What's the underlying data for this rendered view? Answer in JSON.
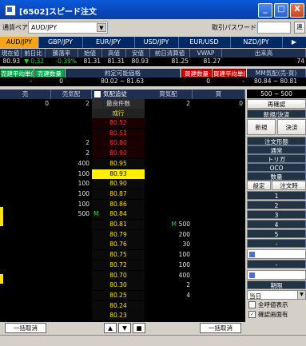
{
  "window": {
    "title": "[6502]スピード注文",
    "min": "_",
    "max": "□",
    "close": "X"
  },
  "toolbar": {
    "pair_label": "通貨ペア",
    "pair_value": "AUD/JPY",
    "password_label": "取引パスワード",
    "password_value": "",
    "link_btn": "連"
  },
  "tabs": [
    "AUD/JPY",
    "GBP/JPY",
    "EUR/JPY",
    "USD/JPY",
    "EUR/USD",
    "NZD/JPY"
  ],
  "market": {
    "headers": [
      "現在値",
      "前日比",
      "騰落率",
      "始値",
      "高値",
      "安値",
      "前日清算値",
      "VWAP",
      "出来高"
    ],
    "values": [
      "80.93",
      "▼",
      "0.32",
      "-0.39%",
      "81.31",
      "81.31",
      "80.93",
      "81.25",
      "81.27",
      "74"
    ]
  },
  "summary": {
    "sell_avg_label": "売建平均単価",
    "sell_qty_label": "売建数量",
    "range_label": "約定可能価格",
    "buy_qty_label": "買建数量",
    "buy_avg_label": "買建平均単価",
    "mm_label": "MM気配(売-買)",
    "sell_avg": "-",
    "sell_qty": "0",
    "range": "80.02 ~ 81.63",
    "buy_qty": "0",
    "buy_avg": "-",
    "mm_value": "80.84 ~ 80.81"
  },
  "board": {
    "col_sell": "売",
    "col_sell_qty": "売気配",
    "chase_label": "気配追従",
    "col_buy_qty": "買気配",
    "col_buy": "買",
    "total_sell": "0",
    "total_sell_qty": "2",
    "total_buy_qty": "2",
    "total_buy": "0",
    "best_label": "最良件数",
    "market_label": "成行",
    "rows": [
      {
        "sell_qty": "",
        "price": "80.52",
        "color": "red",
        "buy_qty": "",
        "mark": ""
      },
      {
        "sell_qty": "",
        "price": "80.51",
        "color": "red",
        "buy_qty": "",
        "mark": ""
      },
      {
        "sell_qty": "2",
        "price": "80.80",
        "color": "red",
        "buy_qty": "",
        "mark": ""
      },
      {
        "sell_qty": "2",
        "price": "80.90",
        "color": "red",
        "buy_qty": "",
        "mark": ""
      },
      {
        "sell_qty": "400",
        "price": "80.95",
        "color": "yellow",
        "buy_qty": "",
        "mark": ""
      },
      {
        "sell_qty": "100",
        "price": "80.93",
        "color": "highlight",
        "buy_qty": "",
        "mark": ""
      },
      {
        "sell_qty": "100",
        "price": "80.90",
        "color": "yellow",
        "buy_qty": "",
        "mark": ""
      },
      {
        "sell_qty": "100",
        "price": "80.87",
        "color": "yellow",
        "buy_qty": "",
        "mark": ""
      },
      {
        "sell_qty": "100",
        "price": "80.86",
        "color": "yellow",
        "buy_qty": "",
        "mark": ""
      },
      {
        "sell_qty": "500",
        "price": "80.84",
        "color": "yellow",
        "buy_qty": "",
        "mark": "M"
      },
      {
        "sell_qty": "",
        "price": "80.81",
        "color": "yellow",
        "buy_qty": "500",
        "mark": "M"
      },
      {
        "sell_qty": "",
        "price": "80.79",
        "color": "yellow",
        "buy_qty": "200",
        "mark": ""
      },
      {
        "sell_qty": "",
        "price": "80.76",
        "color": "yellow",
        "buy_qty": "30",
        "mark": ""
      },
      {
        "sell_qty": "",
        "price": "80.75",
        "color": "yellow",
        "buy_qty": "100",
        "mark": ""
      },
      {
        "sell_qty": "",
        "price": "80.72",
        "color": "yellow",
        "buy_qty": "100",
        "mark": ""
      },
      {
        "sell_qty": "",
        "price": "80.70",
        "color": "yellow",
        "buy_qty": "400",
        "mark": ""
      },
      {
        "sell_qty": "",
        "price": "80.30",
        "color": "yellow",
        "buy_qty": "2",
        "mark": ""
      },
      {
        "sell_qty": "",
        "price": "80.25",
        "color": "yellow",
        "buy_qty": "4",
        "mark": ""
      },
      {
        "sell_qty": "",
        "price": "80.24",
        "color": "yellow",
        "buy_qty": "",
        "mark": ""
      },
      {
        "sell_qty": "",
        "price": "80.23",
        "color": "yellow",
        "buy_qty": "",
        "mark": ""
      }
    ]
  },
  "side": {
    "mm_range": "500 ~ 500",
    "reconfirm": "再確認",
    "new_settle": "新規/決済",
    "new_btn": "新規",
    "settle_btn": "決済",
    "order_form": "注文形態",
    "forms": [
      "通常",
      "トリガ",
      "OCO"
    ],
    "qty_label": "数量",
    "setting": "設定",
    "order_time": "注文時",
    "qty_buttons": [
      "1",
      "2",
      "3",
      "4",
      "5"
    ],
    "dash1": "-",
    "dash2": "-",
    "period_label": "期限",
    "period_value": "当日",
    "check_all": "全呼値表示",
    "check_confirm": "確認画面有"
  },
  "bottom": {
    "cancel_all_left": "一括取消",
    "cancel_all_right": "一括取消",
    "up": "▲",
    "down": "▼",
    "stop": "■"
  },
  "colors": {
    "red": "#ff3030",
    "yellow": "#ffe000",
    "highlight_bg": "#fff000",
    "green": "#00a84d"
  }
}
